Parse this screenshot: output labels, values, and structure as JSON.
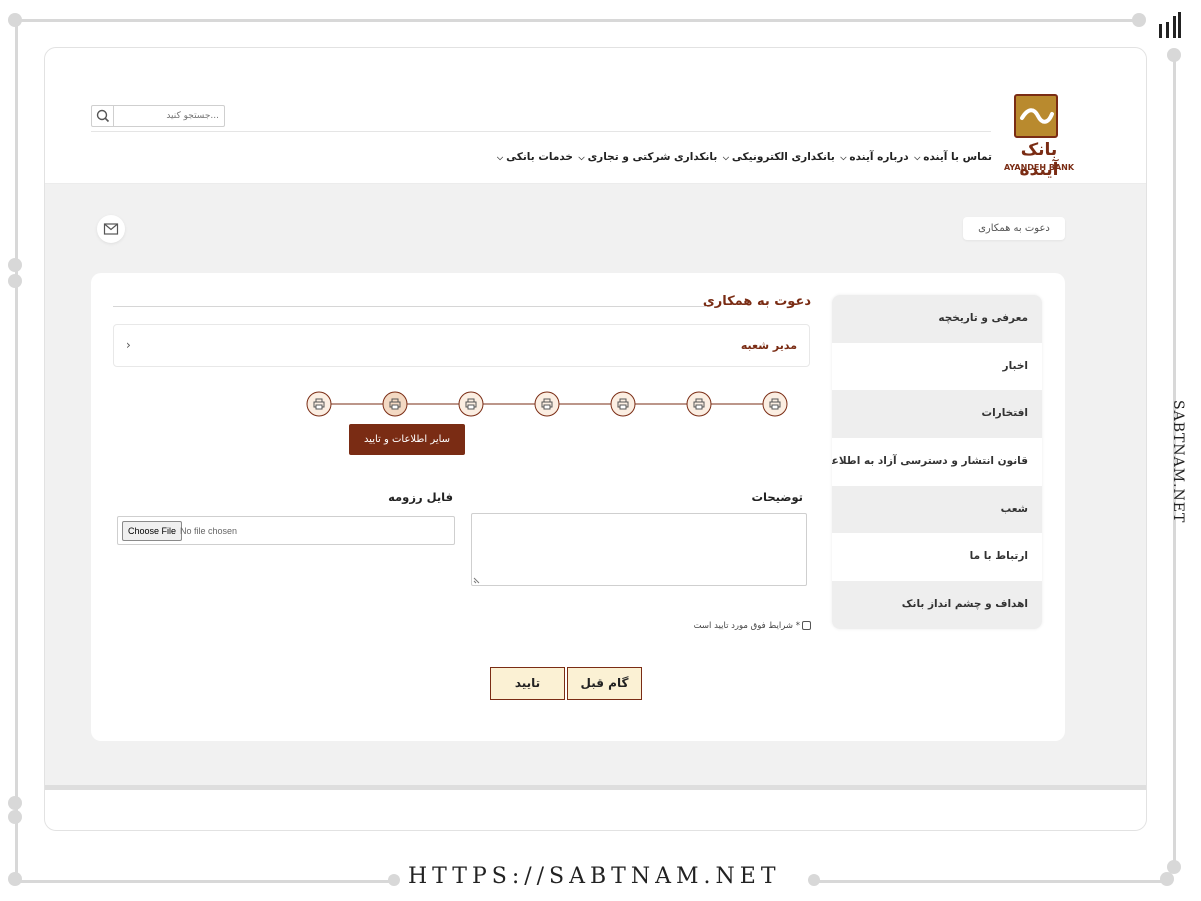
{
  "header": {
    "search": {
      "placeholder": "جستجو کنید..."
    },
    "nav": [
      {
        "label": "خدمات بانکی"
      },
      {
        "label": "بانکداری شرکتی و تجاری"
      },
      {
        "label": "بانکداری الکترونیکی"
      },
      {
        "label": "درباره آینده"
      },
      {
        "label": "تماس با آینده"
      }
    ],
    "logo": {
      "name": "بانک آینده",
      "latin": "AYANDEH BANK"
    }
  },
  "breadcrumb": {
    "label": "دعوت به همکاری"
  },
  "sidebar": {
    "items": [
      {
        "label": "معرفی و تاریخچه"
      },
      {
        "label": "اخبار"
      },
      {
        "label": "افتخارات"
      },
      {
        "label": "قانون انتشار و دسترسی آزاد به اطلاعات"
      },
      {
        "label": "شعب"
      },
      {
        "label": "ارتباط با ما"
      },
      {
        "label": "اهداف و چشم انداز بانک"
      }
    ]
  },
  "section": {
    "title": "دعوت به همکاری",
    "role": "مدیر شعبه",
    "steps_count": 7,
    "active_step": 6,
    "step_tooltip": "سایر اطلاعات و تایید"
  },
  "form": {
    "description_label": "توضیحات",
    "resume_label": "فایل رزومه",
    "file_button": "Choose File",
    "file_status": "No file chosen",
    "agree_label": "* شرایط فوق مورد تایید است",
    "confirm_button": "تایید",
    "prev_button": "گام قبل"
  },
  "watermark": {
    "side_text": "SABTNAM.NET",
    "footer_url": "HTTPS://SABTNAM.NET"
  },
  "colors": {
    "brand": "#7a2c14",
    "brand_gold": "#b98a2e",
    "button_bg": "#fbf1d4",
    "page_bg": "#f1f1f1"
  }
}
